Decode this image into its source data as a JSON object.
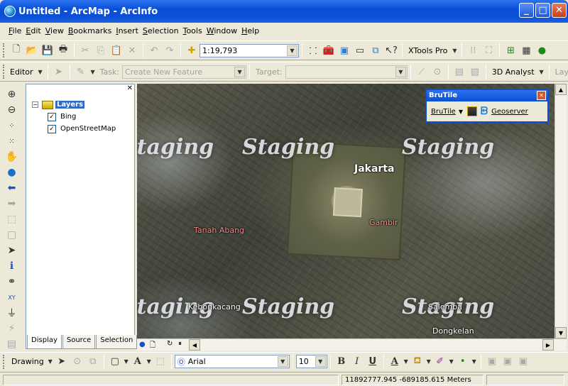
{
  "window": {
    "title": "Untitled - ArcMap - ArcInfo"
  },
  "menu": [
    "File",
    "Edit",
    "View",
    "Bookmarks",
    "Insert",
    "Selection",
    "Tools",
    "Window",
    "Help"
  ],
  "standard_toolbar": {
    "scale": "1:19,793",
    "xtools": "XTools Pro"
  },
  "editor_toolbar": {
    "editor_label": "Editor",
    "task_label": "Task:",
    "task_value": "Create New Feature",
    "target_label": "Target:",
    "target_value": "",
    "analyst": "3D Analyst",
    "overflow_label": "Lay"
  },
  "toc": {
    "root": "Layers",
    "layers": [
      {
        "name": "Bing",
        "checked": true
      },
      {
        "name": "OpenStreetMap",
        "checked": true
      }
    ],
    "tabs": [
      "Display",
      "Source",
      "Selection"
    ]
  },
  "map": {
    "watermark": "Staging",
    "places": {
      "jakarta": "Jakarta",
      "gambir": "Gambir",
      "tanah_abang": "Tanah Abang",
      "kebon_kacang": "Kebonkacang",
      "salemba": "Salemba",
      "dengkelan": "Dongkelan"
    }
  },
  "brutile": {
    "title": "BruTile",
    "menu": "BruTile",
    "geoserver": "Geoserver"
  },
  "drawing_toolbar": {
    "drawing": "Drawing",
    "font": "Arial",
    "size": "10"
  },
  "status": {
    "coords": "11892777.945  -689185.615 Meters"
  }
}
